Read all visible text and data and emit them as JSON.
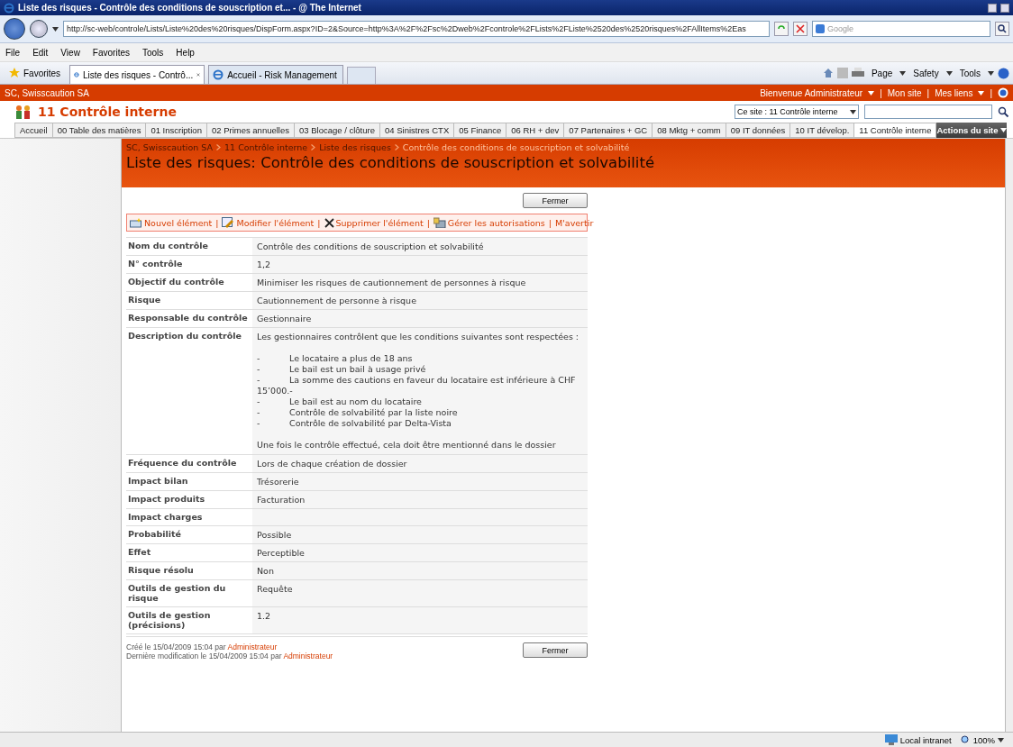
{
  "window": {
    "title": "Liste des risques - Contrôle des conditions de souscription et... - @ The Internet"
  },
  "address_bar": {
    "url": "http://sc-web/controle/Lists/Liste%20des%20risques/DispForm.aspx?ID=2&Source=http%3A%2F%2Fsc%2Dweb%2Fcontrole%2FLists%2FListe%2520des%2520risques%2FAllItems%2Eas",
    "search_placeholder": "Google"
  },
  "menu": [
    "File",
    "Edit",
    "View",
    "Favorites",
    "Tools",
    "Help"
  ],
  "favorites": "Favorites",
  "browser_tabs": [
    {
      "label": "Liste des risques - Contrô...",
      "selected": true
    },
    {
      "label": "Accueil - Risk Management",
      "selected": false
    }
  ],
  "command_bar": [
    "Page",
    "Safety",
    "Tools"
  ],
  "site_bar": {
    "site": "SC, Swisscaution SA",
    "separators": [
      "|",
      "|",
      "|"
    ],
    "welcome": "Bienvenue Administrateur",
    "links": [
      "Mon site",
      "Mes liens"
    ]
  },
  "site_header": {
    "title": "11 Contrôle interne",
    "scope": "Ce site : 11 Contrôle interne"
  },
  "nav_tabs": [
    {
      "label": "Accueil",
      "selected": false
    },
    {
      "label": "00 Table des matières",
      "selected": false
    },
    {
      "label": "01 Inscription",
      "selected": false
    },
    {
      "label": "02 Primes annuelles",
      "selected": false
    },
    {
      "label": "03 Blocage / clôture",
      "selected": false
    },
    {
      "label": "04 Sinistres CTX",
      "selected": false
    },
    {
      "label": "05 Finance",
      "selected": false
    },
    {
      "label": "06 RH + dev",
      "selected": false
    },
    {
      "label": "07 Partenaires + GC",
      "selected": false
    },
    {
      "label": "08 Mktg + comm",
      "selected": false
    },
    {
      "label": "09 IT données",
      "selected": false
    },
    {
      "label": "10 IT dévelop.",
      "selected": false
    },
    {
      "label": "11 Contrôle interne",
      "selected": true
    }
  ],
  "site_actions": "Actions du site",
  "breadcrumb": [
    "SC, Swisscaution SA",
    "11 Contrôle interne",
    "Liste des risques",
    "Contrôle des conditions de souscription et solvabilité"
  ],
  "page_title": "Liste des risques: Contrôle des conditions de souscription et solvabilité",
  "close_button_top": "Fermer",
  "close_button_bottom": "Fermer",
  "toolbar": [
    {
      "kind": "new",
      "label": "Nouvel élément"
    },
    {
      "kind": "edit",
      "label": "Modifier l'élément",
      "separator": "|"
    },
    {
      "kind": "delete",
      "label": "Supprimer l'élément",
      "separator": "|"
    },
    {
      "kind": "permissions",
      "label": "Gérer les autorisations",
      "separator": "|"
    },
    {
      "kind": "alert",
      "label": "M'avertir",
      "separator": "|"
    }
  ],
  "fields": [
    {
      "label": "Nom du contrôle",
      "value": "Contrôle des conditions de souscription et solvabilité"
    },
    {
      "label": "N° contrôle",
      "value": "1,2"
    },
    {
      "label": "Objectif du contrôle",
      "value": "Minimiser les risques de cautionnement de personnes à risque"
    },
    {
      "label": "Risque",
      "value": "Cautionnement de personne à risque"
    },
    {
      "label": "Responsable du contrôle",
      "value": "Gestionnaire"
    },
    {
      "label": "Description du contrôle",
      "description": {
        "intro": "Les gestionnaires contrôlent que les conditions suivantes sont respectées :",
        "items": [
          {
            "marker": "-",
            "text": "Le locataire a plus de 18 ans"
          },
          {
            "marker": "-",
            "text": "Le bail est un bail à usage privé"
          },
          {
            "marker": "-",
            "text": "La somme des cautions en faveur du locataire est inférieure à CHF 15’000.-"
          },
          {
            "marker": "-",
            "text": "Le bail est au nom du locataire"
          },
          {
            "marker": "-",
            "text": "Contrôle de solvabilité par la liste noire"
          },
          {
            "marker": "-",
            "text": "Contrôle de solvabilité par Delta-Vista"
          }
        ],
        "closing": "Une fois le contrôle effectué, cela doit être mentionné dans le dossier"
      }
    },
    {
      "label": "Fréquence du contrôle",
      "value": "Lors de chaque création de dossier"
    },
    {
      "label": "Impact bilan",
      "value": "Trésorerie"
    },
    {
      "label": "Impact produits",
      "value": "Facturation"
    },
    {
      "label": "Impact charges"
    },
    {
      "label": "Probabilité",
      "value": "Possible"
    },
    {
      "label": "Effet",
      "value": "Perceptible"
    },
    {
      "label": "Risque résolu",
      "value": "Non"
    },
    {
      "label": "Outils de gestion du risque",
      "value": "Requête"
    },
    {
      "label": "Outils de gestion (précisions)",
      "value": "1.2"
    }
  ],
  "footer": {
    "created": {
      "text": "Créé le 15/04/2009 15:04 par",
      "author": "Administrateur"
    },
    "modified": {
      "text": "Dernière modification le 15/04/2009 15:04 par",
      "author": "Administrateur"
    }
  },
  "status_bar": {
    "zone": "Local intranet",
    "zoom": "100%"
  }
}
